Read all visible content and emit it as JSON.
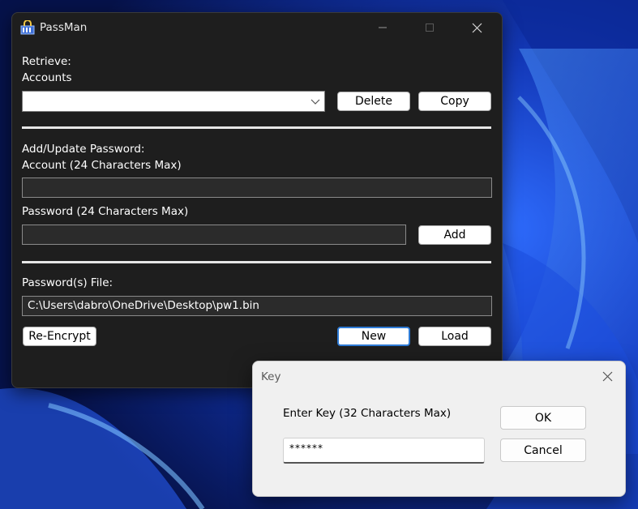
{
  "app": {
    "title": "PassMan",
    "icon": "passman-app-icon"
  },
  "window_controls": {
    "minimize_icon": "minimize-icon",
    "maximize_icon": "maximize-icon",
    "close_icon": "close-icon"
  },
  "retrieve": {
    "heading": "Retrieve:",
    "accounts_label": "Accounts",
    "accounts_value": "",
    "delete_label": "Delete",
    "copy_label": "Copy"
  },
  "add_update": {
    "heading": "Add/Update Password:",
    "account_label": "Account (24 Characters Max)",
    "account_value": "",
    "password_label": "Password (24 Characters Max)",
    "password_value": "",
    "add_label": "Add"
  },
  "file": {
    "heading": "Password(s) File:",
    "path": "C:\\Users\\dabro\\OneDrive\\Desktop\\pw1.bin",
    "reencrypt_label": "Re-Encrypt",
    "new_label": "New",
    "load_label": "Load"
  },
  "key_dialog": {
    "title": "Key",
    "prompt": "Enter Key (32 Characters Max)",
    "input_value": "******",
    "ok_label": "OK",
    "cancel_label": "Cancel"
  },
  "colors": {
    "window_bg": "#1e1e1e",
    "dialog_bg": "#f0f0f0",
    "accent": "#2e7bd6",
    "wallpaper": "#0a1f6e"
  }
}
